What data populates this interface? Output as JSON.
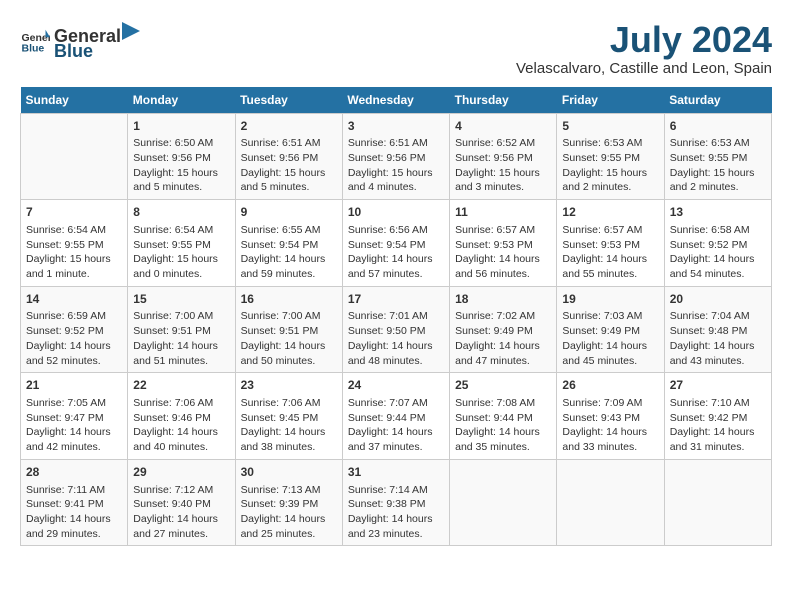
{
  "header": {
    "logo_general": "General",
    "logo_blue": "Blue",
    "month_year": "July 2024",
    "location": "Velascalvaro, Castille and Leon, Spain"
  },
  "days_of_week": [
    "Sunday",
    "Monday",
    "Tuesday",
    "Wednesday",
    "Thursday",
    "Friday",
    "Saturday"
  ],
  "weeks": [
    [
      {
        "day": "",
        "content": ""
      },
      {
        "day": "1",
        "content": "Sunrise: 6:50 AM\nSunset: 9:56 PM\nDaylight: 15 hours\nand 5 minutes."
      },
      {
        "day": "2",
        "content": "Sunrise: 6:51 AM\nSunset: 9:56 PM\nDaylight: 15 hours\nand 5 minutes."
      },
      {
        "day": "3",
        "content": "Sunrise: 6:51 AM\nSunset: 9:56 PM\nDaylight: 15 hours\nand 4 minutes."
      },
      {
        "day": "4",
        "content": "Sunrise: 6:52 AM\nSunset: 9:56 PM\nDaylight: 15 hours\nand 3 minutes."
      },
      {
        "day": "5",
        "content": "Sunrise: 6:53 AM\nSunset: 9:55 PM\nDaylight: 15 hours\nand 2 minutes."
      },
      {
        "day": "6",
        "content": "Sunrise: 6:53 AM\nSunset: 9:55 PM\nDaylight: 15 hours\nand 2 minutes."
      }
    ],
    [
      {
        "day": "7",
        "content": "Sunrise: 6:54 AM\nSunset: 9:55 PM\nDaylight: 15 hours\nand 1 minute."
      },
      {
        "day": "8",
        "content": "Sunrise: 6:54 AM\nSunset: 9:55 PM\nDaylight: 15 hours\nand 0 minutes."
      },
      {
        "day": "9",
        "content": "Sunrise: 6:55 AM\nSunset: 9:54 PM\nDaylight: 14 hours\nand 59 minutes."
      },
      {
        "day": "10",
        "content": "Sunrise: 6:56 AM\nSunset: 9:54 PM\nDaylight: 14 hours\nand 57 minutes."
      },
      {
        "day": "11",
        "content": "Sunrise: 6:57 AM\nSunset: 9:53 PM\nDaylight: 14 hours\nand 56 minutes."
      },
      {
        "day": "12",
        "content": "Sunrise: 6:57 AM\nSunset: 9:53 PM\nDaylight: 14 hours\nand 55 minutes."
      },
      {
        "day": "13",
        "content": "Sunrise: 6:58 AM\nSunset: 9:52 PM\nDaylight: 14 hours\nand 54 minutes."
      }
    ],
    [
      {
        "day": "14",
        "content": "Sunrise: 6:59 AM\nSunset: 9:52 PM\nDaylight: 14 hours\nand 52 minutes."
      },
      {
        "day": "15",
        "content": "Sunrise: 7:00 AM\nSunset: 9:51 PM\nDaylight: 14 hours\nand 51 minutes."
      },
      {
        "day": "16",
        "content": "Sunrise: 7:00 AM\nSunset: 9:51 PM\nDaylight: 14 hours\nand 50 minutes."
      },
      {
        "day": "17",
        "content": "Sunrise: 7:01 AM\nSunset: 9:50 PM\nDaylight: 14 hours\nand 48 minutes."
      },
      {
        "day": "18",
        "content": "Sunrise: 7:02 AM\nSunset: 9:49 PM\nDaylight: 14 hours\nand 47 minutes."
      },
      {
        "day": "19",
        "content": "Sunrise: 7:03 AM\nSunset: 9:49 PM\nDaylight: 14 hours\nand 45 minutes."
      },
      {
        "day": "20",
        "content": "Sunrise: 7:04 AM\nSunset: 9:48 PM\nDaylight: 14 hours\nand 43 minutes."
      }
    ],
    [
      {
        "day": "21",
        "content": "Sunrise: 7:05 AM\nSunset: 9:47 PM\nDaylight: 14 hours\nand 42 minutes."
      },
      {
        "day": "22",
        "content": "Sunrise: 7:06 AM\nSunset: 9:46 PM\nDaylight: 14 hours\nand 40 minutes."
      },
      {
        "day": "23",
        "content": "Sunrise: 7:06 AM\nSunset: 9:45 PM\nDaylight: 14 hours\nand 38 minutes."
      },
      {
        "day": "24",
        "content": "Sunrise: 7:07 AM\nSunset: 9:44 PM\nDaylight: 14 hours\nand 37 minutes."
      },
      {
        "day": "25",
        "content": "Sunrise: 7:08 AM\nSunset: 9:44 PM\nDaylight: 14 hours\nand 35 minutes."
      },
      {
        "day": "26",
        "content": "Sunrise: 7:09 AM\nSunset: 9:43 PM\nDaylight: 14 hours\nand 33 minutes."
      },
      {
        "day": "27",
        "content": "Sunrise: 7:10 AM\nSunset: 9:42 PM\nDaylight: 14 hours\nand 31 minutes."
      }
    ],
    [
      {
        "day": "28",
        "content": "Sunrise: 7:11 AM\nSunset: 9:41 PM\nDaylight: 14 hours\nand 29 minutes."
      },
      {
        "day": "29",
        "content": "Sunrise: 7:12 AM\nSunset: 9:40 PM\nDaylight: 14 hours\nand 27 minutes."
      },
      {
        "day": "30",
        "content": "Sunrise: 7:13 AM\nSunset: 9:39 PM\nDaylight: 14 hours\nand 25 minutes."
      },
      {
        "day": "31",
        "content": "Sunrise: 7:14 AM\nSunset: 9:38 PM\nDaylight: 14 hours\nand 23 minutes."
      },
      {
        "day": "",
        "content": ""
      },
      {
        "day": "",
        "content": ""
      },
      {
        "day": "",
        "content": ""
      }
    ]
  ]
}
